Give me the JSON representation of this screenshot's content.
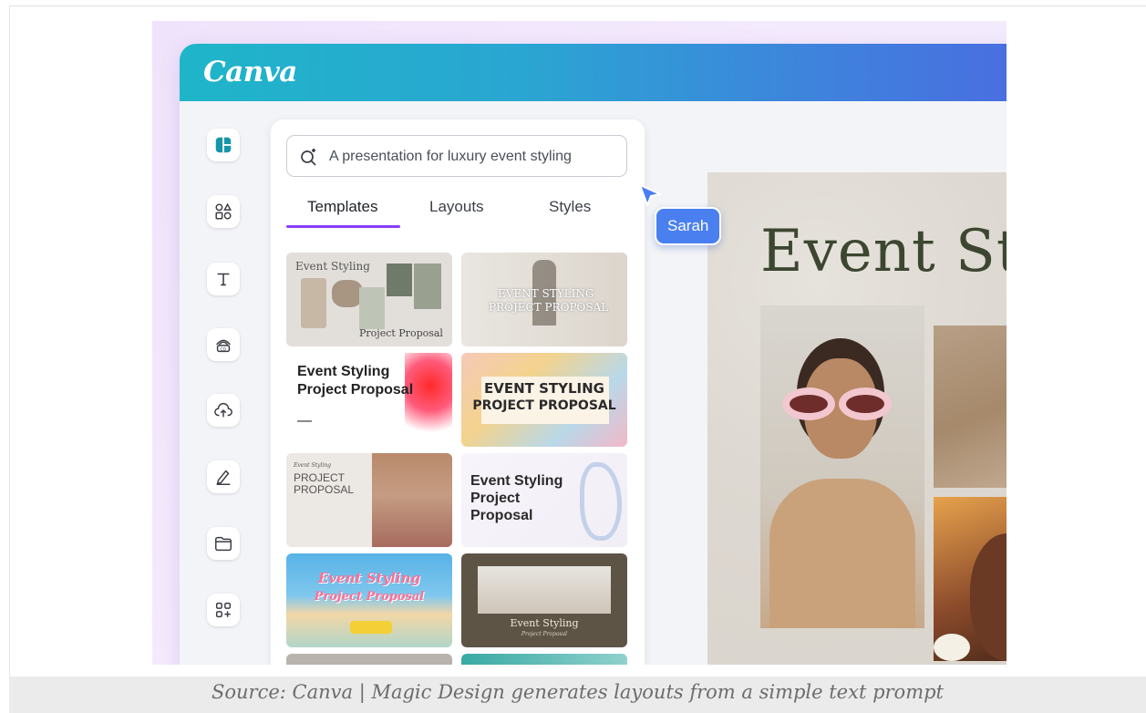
{
  "app": {
    "logo": "Canva"
  },
  "search": {
    "text": "A presentation for luxury event styling"
  },
  "tabs": [
    {
      "label": "Templates",
      "active": true
    },
    {
      "label": "Layouts"
    },
    {
      "label": "Styles"
    }
  ],
  "templates": [
    {
      "line1": "Event Styling",
      "line2": "Project Proposal"
    },
    {
      "line1": "EVENT STYLING",
      "line2": "PROJECT PROPOSAL"
    },
    {
      "line1": "Event Styling",
      "line2": "Project Proposal",
      "line3": "—"
    },
    {
      "line1": "EVENT STYLING",
      "line2": "PROJECT PROPOSAL"
    },
    {
      "line1": "Event Styling",
      "line2": "PROJECT",
      "line3": "PROPOSAL"
    },
    {
      "line1": "Event Styling",
      "line2": "Project",
      "line3": "Proposal"
    },
    {
      "line1": "Event Styling",
      "line2": "Project Proposal"
    },
    {
      "line1": "Event Styling",
      "line2": "Project Proposal"
    }
  ],
  "collaborator": {
    "name": "Sarah"
  },
  "canvas": {
    "title": "Event Sty"
  },
  "caption": "Source: Canva | Magic Design generates layouts from a simple text prompt",
  "colors": {
    "accent": "#8b3dff",
    "collab": "#4a7ff0",
    "title_text": "#3c4630"
  },
  "icons": [
    "design-icon",
    "elements-icon",
    "text-icon",
    "brand-icon",
    "uploads-icon",
    "draw-icon",
    "projects-icon",
    "apps-icon",
    "magic-search-icon",
    "cursor-icon"
  ]
}
